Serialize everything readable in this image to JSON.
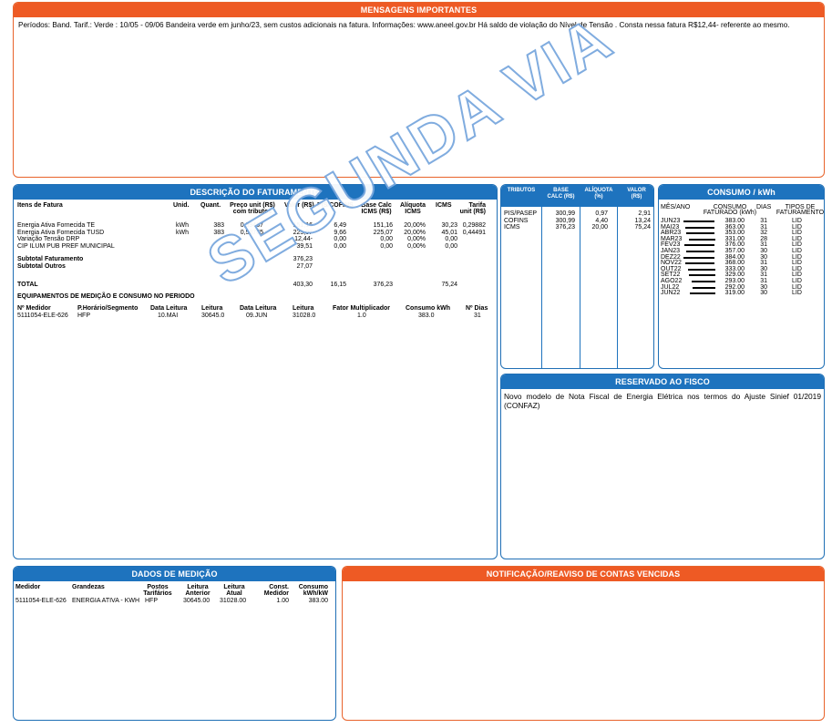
{
  "mensagens": {
    "title": "MENSAGENS IMPORTANTES",
    "text": "Períodos: Band. Tarif.: Verde : 10/05 - 09/06 Bandeira verde em junho/23, sem custos adicionais na fatura. Informações: www.aneel.gov.br Há saldo de violação do Nível de Tensão . Consta nessa fatura R$12,44- referente ao mesmo."
  },
  "faturamento": {
    "title": "DESCRIÇÃO DO FATURAMENTO",
    "headers": {
      "itens": "Itens de Fatura",
      "unid": "Unid.",
      "quant": "Quant.",
      "preco": "Preço unit (R$)",
      "preco2": "com tributos",
      "valor": "Valor (R$)",
      "pis": "PIS/COFINS",
      "base": "Base Calc",
      "base2": "ICMS (R$)",
      "aliq": "Alíquota",
      "aliq2": "ICMS",
      "icms": "ICMS",
      "tarifa": "Tarifa",
      "tarifa2": "unit (R$)"
    },
    "rows": [
      {
        "item": "Energia Ativa Fornecida TE",
        "unid": "kWh",
        "quant": "383",
        "preco": "0,39467",
        "valor": "151,16",
        "pis": "6,49",
        "base": "151,16",
        "aliq": "20,00%",
        "icms": "30,23",
        "tarifa": "0,29882"
      },
      {
        "item": "Energia Ativa Fornecida TUSD",
        "unid": "kWh",
        "quant": "383",
        "preco": "0,58765",
        "valor": "225,07",
        "pis": "9,66",
        "base": "225,07",
        "aliq": "20,00%",
        "icms": "45,01",
        "tarifa": "0,44491"
      },
      {
        "item": "Variação Tensão DRP",
        "unid": "",
        "quant": "",
        "preco": "",
        "valor": "12,44-",
        "pis": "0,00",
        "base": "0,00",
        "aliq": "0,00%",
        "icms": "0,00",
        "tarifa": ""
      },
      {
        "item": "CIP ILUM PUB PREF MUNICIPAL",
        "unid": "",
        "quant": "",
        "preco": "",
        "valor": "39,51",
        "pis": "0,00",
        "base": "0,00",
        "aliq": "0,00%",
        "icms": "0,00",
        "tarifa": ""
      }
    ],
    "subtotal_fat_label": "Subtotal Faturamento",
    "subtotal_fat": "376,23",
    "subtotal_out_label": "Subtotal Outros",
    "subtotal_out": "27,07",
    "total_label": "TOTAL",
    "total_valor": "403,30",
    "total_pis": "16,15",
    "total_base": "376,23",
    "total_icms": "75,24",
    "equip_title": "EQUIPAMENTOS DE MEDIÇÃO E CONSUMO NO PERIODO",
    "equip_headers": {
      "medidor": "Nº Medidor",
      "horario": "P.Horário/Segmento",
      "data_leit": "Data Leitura",
      "leitura": "Leitura",
      "data_leit2": "Data Leitura",
      "leitura2": "Leitura",
      "fator": "Fator Multiplicador",
      "consumo": "Consumo kWh",
      "dias": "Nº Dias"
    },
    "equip_row": {
      "medidor": "5111054-ELE-626",
      "horario": "HFP",
      "data_leit": "10.MAI",
      "leitura": "30645.0",
      "data_leit2": "09.JUN",
      "leitura2": "31028.0",
      "fator": "1.0",
      "consumo": "383.0",
      "dias": "31"
    }
  },
  "tributos": {
    "headers": {
      "tributos": "TRIBUTOS",
      "base": "BASE",
      "base2": "CALC (R$)",
      "aliq": "ALÍQUOTA",
      "aliq2": "(%)",
      "valor": "VALOR",
      "valor2": "(R$)"
    },
    "rows": [
      {
        "nome": "PIS/PASEP",
        "base": "300,99",
        "aliq": "0,97",
        "valor": "2,91"
      },
      {
        "nome": "COFINS",
        "base": "300,99",
        "aliq": "4,40",
        "valor": "13,24"
      },
      {
        "nome": "ICMS",
        "base": "376,23",
        "aliq": "20,00",
        "valor": "75,24"
      }
    ]
  },
  "consumo": {
    "title": "CONSUMO / kWh",
    "headers": {
      "mes": "MÊS/ANO",
      "consumo": "CONSUMO",
      "consumo2": "FATURADO (kWh)",
      "dias": "DIAS",
      "tipos": "TIPOS DE",
      "tipos2": "FATURAMENTO"
    },
    "rows": [
      {
        "mes": "JUN23",
        "kwh": "383.00",
        "dias": "31",
        "tipo": "LID",
        "v": 383
      },
      {
        "mes": "MAI23",
        "kwh": "363.00",
        "dias": "31",
        "tipo": "LID",
        "v": 363
      },
      {
        "mes": "ABR23",
        "kwh": "353.00",
        "dias": "32",
        "tipo": "LID",
        "v": 353
      },
      {
        "mes": "MAR23",
        "kwh": "331.00",
        "dias": "28",
        "tipo": "LID",
        "v": 331
      },
      {
        "mes": "FEV23",
        "kwh": "376.00",
        "dias": "31",
        "tipo": "LID",
        "v": 376
      },
      {
        "mes": "JAN23",
        "kwh": "357.00",
        "dias": "30",
        "tipo": "LID",
        "v": 357
      },
      {
        "mes": "DEZ22",
        "kwh": "384.00",
        "dias": "30",
        "tipo": "LID",
        "v": 384
      },
      {
        "mes": "NOV22",
        "kwh": "368.00",
        "dias": "31",
        "tipo": "LID",
        "v": 368
      },
      {
        "mes": "OUT22",
        "kwh": "333.00",
        "dias": "30",
        "tipo": "LID",
        "v": 333
      },
      {
        "mes": "SET22",
        "kwh": "329.00",
        "dias": "31",
        "tipo": "LID",
        "v": 329
      },
      {
        "mes": "AGO22",
        "kwh": "293.00",
        "dias": "31",
        "tipo": "LID",
        "v": 293
      },
      {
        "mes": "JUL22",
        "kwh": "292.00",
        "dias": "30",
        "tipo": "LID",
        "v": 292
      },
      {
        "mes": "JUN22",
        "kwh": "319.00",
        "dias": "30",
        "tipo": "LID",
        "v": 319
      }
    ]
  },
  "fisco": {
    "title": "RESERVADO AO FISCO",
    "text": "Novo modelo de Nota Fiscal de Energia Elétrica nos termos do Ajuste Sinief 01/2019 (CONFAZ)"
  },
  "medicao": {
    "title": "DADOS DE MEDIÇÃO",
    "headers": {
      "medidor": "Medidor",
      "grandezas": "Grandezas",
      "postos": "Postos",
      "postos2": "Tarifários",
      "leit_ant": "Leitura",
      "leit_ant2": "Anterior",
      "leit_at": "Leitura",
      "leit_at2": "Atual",
      "const": "Const.",
      "const2": "Medidor",
      "consumo": "Consumo",
      "consumo2": "kWh/kW"
    },
    "row": {
      "medidor": "5111054-ELE-626",
      "grandezas": "ENERGIA ATIVA - KWH",
      "postos": "HFP",
      "leit_ant": "30645.00",
      "leit_at": "31028.00",
      "const": "1.00",
      "consumo": "383.00"
    }
  },
  "notificacao": {
    "title": "NOTIFICAÇÃO/REAVISO DE CONTAS VENCIDAS"
  },
  "watermark": "SEGUNDA VIA"
}
